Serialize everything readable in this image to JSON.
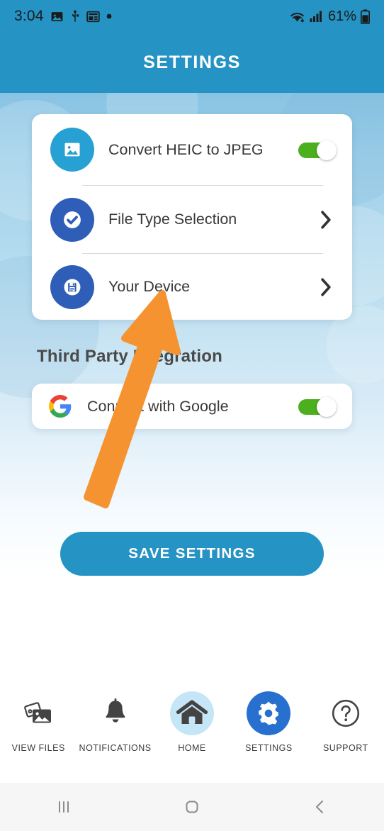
{
  "status_bar": {
    "time": "3:04",
    "battery_percent": "61%",
    "left_icons": [
      "image-icon",
      "usb-icon",
      "screenshot-icon",
      "dot-icon"
    ],
    "right_icons": [
      "wifi-icon",
      "cellular-signal-icon",
      "battery-icon"
    ]
  },
  "header": {
    "title": "SETTINGS",
    "background_color": "#2593c4"
  },
  "settings_card": {
    "rows": [
      {
        "label": "Convert HEIC to JPEG",
        "icon": "image-icon",
        "icon_color": "#27a0d4",
        "control": "toggle",
        "toggle_on": true
      },
      {
        "label": "File Type Selection",
        "icon": "check-circle-icon",
        "icon_color": "#2e5eb8",
        "control": "chevron",
        "toggle_on": null
      },
      {
        "label": "Your Device",
        "icon": "save-disk-icon",
        "icon_color": "#2e5eb8",
        "control": "chevron",
        "toggle_on": null
      }
    ]
  },
  "third_party": {
    "section_title": "Third Party Integration",
    "row": {
      "label": "Connect with Google",
      "icon": "google-g-icon",
      "control": "toggle",
      "toggle_on": true
    }
  },
  "save_button": {
    "label": "SAVE SETTINGS",
    "color": "#2593c4"
  },
  "annotation": {
    "type": "arrow",
    "color": "#f59331",
    "points_to": "Your Device"
  },
  "bottom_nav": {
    "items": [
      {
        "label": "VIEW FILES",
        "icon": "photos-stack-icon",
        "active": false
      },
      {
        "label": "NOTIFICATIONS",
        "icon": "bell-icon",
        "active": false
      },
      {
        "label": "HOME",
        "icon": "home-icon",
        "active": false,
        "highlight": true
      },
      {
        "label": "SETTINGS",
        "icon": "gear-icon",
        "active": true
      },
      {
        "label": "SUPPORT",
        "icon": "question-circle-icon",
        "active": false
      }
    ],
    "active_color": "#2770cf",
    "home_highlight_color": "#c5e6f7"
  },
  "system_nav": {
    "buttons": [
      {
        "name": "recents",
        "icon": "recents-icon"
      },
      {
        "name": "home",
        "icon": "home-square-icon"
      },
      {
        "name": "back",
        "icon": "back-chevron-icon"
      }
    ]
  },
  "toggle_colors": {
    "on_track": "#4caf1e",
    "knob": "#ffffff"
  }
}
